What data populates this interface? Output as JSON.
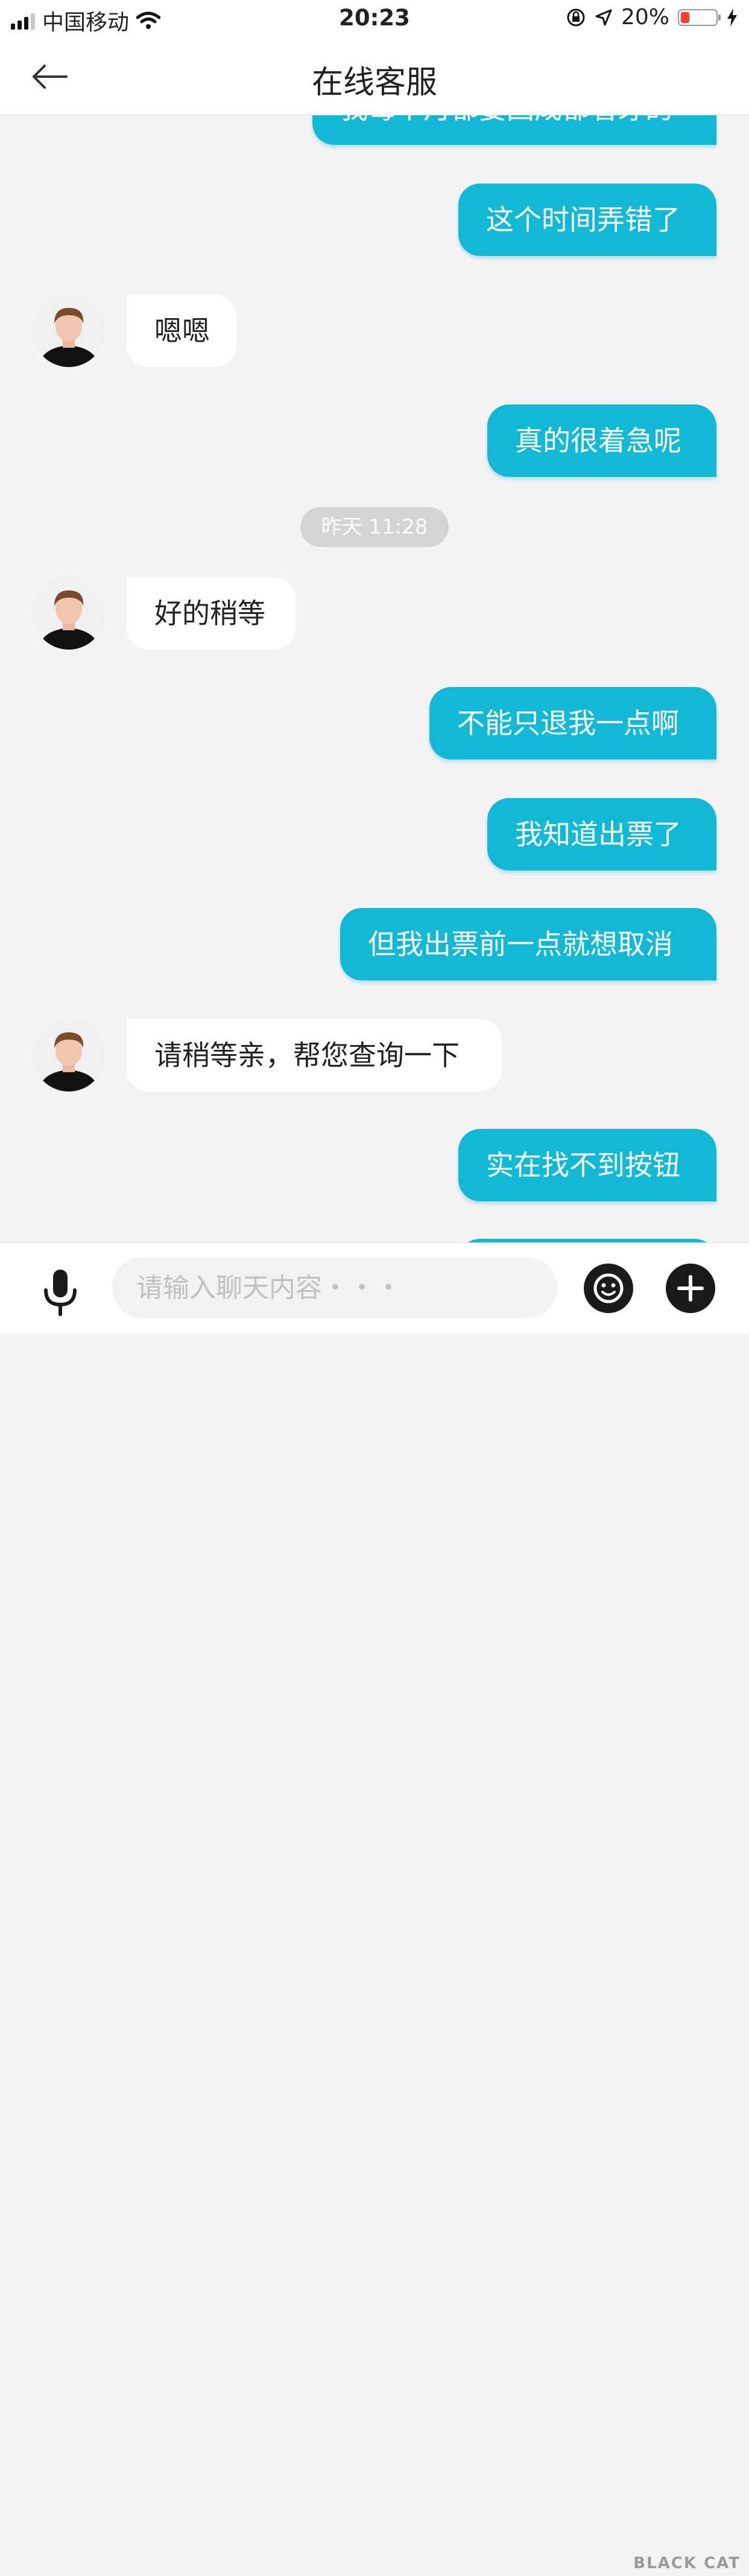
{
  "status_bar": {
    "carrier": "中国移动",
    "time": "20:23",
    "battery_percent": "20%",
    "battery_level": 0.2,
    "icons": [
      "signal-icon",
      "wifi-icon",
      "orientation-lock-icon",
      "location-icon",
      "battery-icon",
      "charging-icon"
    ]
  },
  "nav": {
    "title": "在线客服",
    "back_icon": "back-arrow-icon"
  },
  "chat": {
    "top_partial_message": "我每个月都要回成都看牙的",
    "messages": [
      {
        "side": "right",
        "text": "这个时间弄错了"
      },
      {
        "side": "left",
        "text": "嗯嗯"
      },
      {
        "side": "right",
        "text": "真的很着急呢"
      },
      {
        "side": "time",
        "text": "昨天 11:28"
      },
      {
        "side": "left",
        "text": "好的稍等"
      },
      {
        "side": "right",
        "text": "不能只退我一点啊"
      },
      {
        "side": "right",
        "text": "我知道出票了"
      },
      {
        "side": "right",
        "text": "但我出票前一点就想取消"
      },
      {
        "side": "left",
        "text": "请稍等亲，帮您查询一下"
      },
      {
        "side": "right",
        "text": "实在找不到按钮"
      }
    ]
  },
  "input_bar": {
    "placeholder": "请输入聊天内容・・・",
    "value": ""
  },
  "watermark": {
    "text": "BLACK CAT"
  },
  "colors": {
    "accent": "#12b9d4",
    "background": "#f3f3f4",
    "battery_low": "#ff3b30"
  }
}
